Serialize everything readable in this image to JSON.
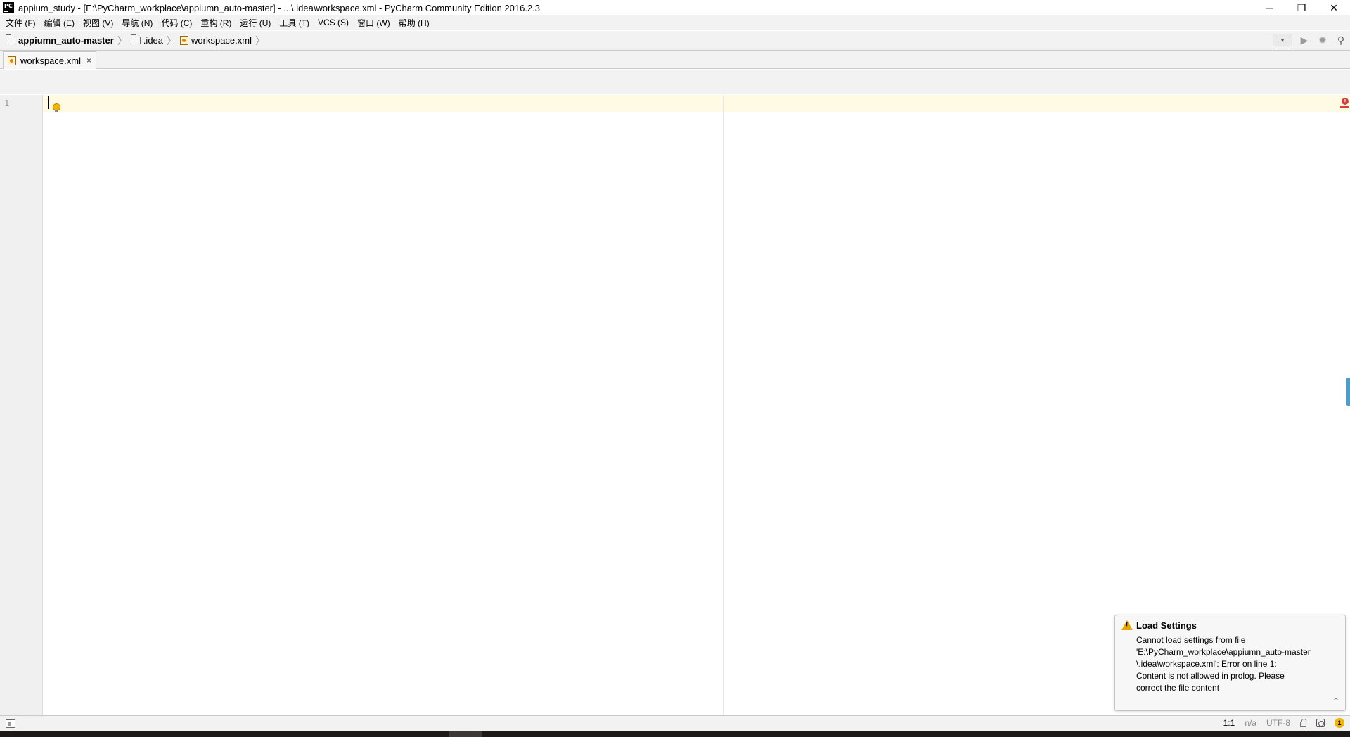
{
  "window": {
    "title": "appium_study - [E:\\PyCharm_workplace\\appiumn_auto-master] - ...\\.idea\\workspace.xml - PyCharm Community Edition 2016.2.3",
    "logo_text": "PC",
    "controls": {
      "minimize": "─",
      "restore": "❐",
      "close": "✕"
    }
  },
  "menu": {
    "items": [
      {
        "label": "文件 (F)"
      },
      {
        "label": "编辑 (E)"
      },
      {
        "label": "视图 (V)"
      },
      {
        "label": "导航 (N)"
      },
      {
        "label": "代码 (C)"
      },
      {
        "label": "重构 (R)"
      },
      {
        "label": "运行 (U)"
      },
      {
        "label": "工具 (T)"
      },
      {
        "label": "VCS (S)"
      },
      {
        "label": "窗口 (W)"
      },
      {
        "label": "帮助 (H)"
      }
    ]
  },
  "navbar": {
    "crumbs": [
      {
        "label": "appiumn_auto-master",
        "icon": "folder-icon"
      },
      {
        "label": ".idea",
        "icon": "folder-icon"
      },
      {
        "label": "workspace.xml",
        "icon": "xml-file-icon"
      }
    ],
    "separator": "〉",
    "tools": {
      "run_config": "▾",
      "run": "▶",
      "debug": "✹",
      "search": "⚲"
    }
  },
  "tabs": [
    {
      "label": "workspace.xml",
      "close": "×",
      "icon": "xml-file-icon"
    }
  ],
  "editor": {
    "line_numbers": [
      "1"
    ],
    "error_marker": "!"
  },
  "notification": {
    "title": "Load Settings",
    "body_lines": [
      "Cannot load settings from file",
      "'E:\\PyCharm_workplace\\appiumn_auto-master",
      "\\.idea\\workspace.xml': Error on line 1:",
      "Content is not allowed in prolog. Please",
      "correct the file content"
    ],
    "collapse": "⌃",
    "icon": "warning-icon"
  },
  "statusbar": {
    "position": "1:1",
    "line_separator": "n/a",
    "encoding": "UTF-8",
    "event_count": "1"
  },
  "colors": {
    "current_line": "#fffae3",
    "warning": "#e8a800",
    "error": "#d43c3c",
    "scroll_marker": "#4a9ecb"
  }
}
